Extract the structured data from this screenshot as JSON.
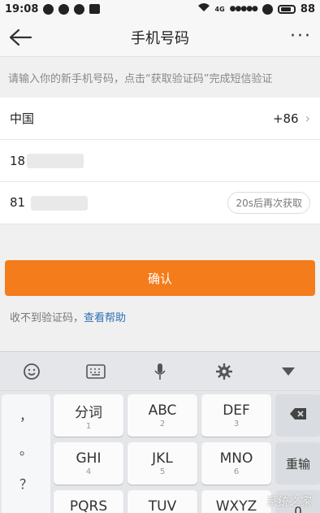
{
  "status": {
    "time": "19:08",
    "network": "4G",
    "battery": "88"
  },
  "titlebar": {
    "title": "手机号码",
    "more": "···"
  },
  "hint": "请输入你的新手机号码，点击“获取验证码”完成短信验证",
  "country": {
    "name": "中国",
    "code": "+86"
  },
  "phone_input": {
    "prefix": "18"
  },
  "code_input": {
    "prefix": "81",
    "resend_label": "20s后再次获取"
  },
  "confirm_label": "确认",
  "help": {
    "prefix": "收不到验证码，",
    "link": "查看帮助"
  },
  "keyboard": {
    "punctuation": [
      "，",
      "。",
      "？",
      "！"
    ],
    "keys": [
      {
        "big": "分词",
        "small": "1"
      },
      {
        "big": "ABC",
        "small": "2"
      },
      {
        "big": "DEF",
        "small": "3"
      },
      {
        "big": "GHI",
        "small": "4"
      },
      {
        "big": "JKL",
        "small": "5"
      },
      {
        "big": "MNO",
        "small": "6"
      },
      {
        "big": "PQRS",
        "small": "7"
      },
      {
        "big": "TUV",
        "small": "8"
      },
      {
        "big": "WXYZ",
        "small": "9"
      }
    ],
    "delete_icon": "backspace-icon",
    "reenter_label": "重输",
    "zero_label": "0"
  },
  "watermark": "系统之家"
}
